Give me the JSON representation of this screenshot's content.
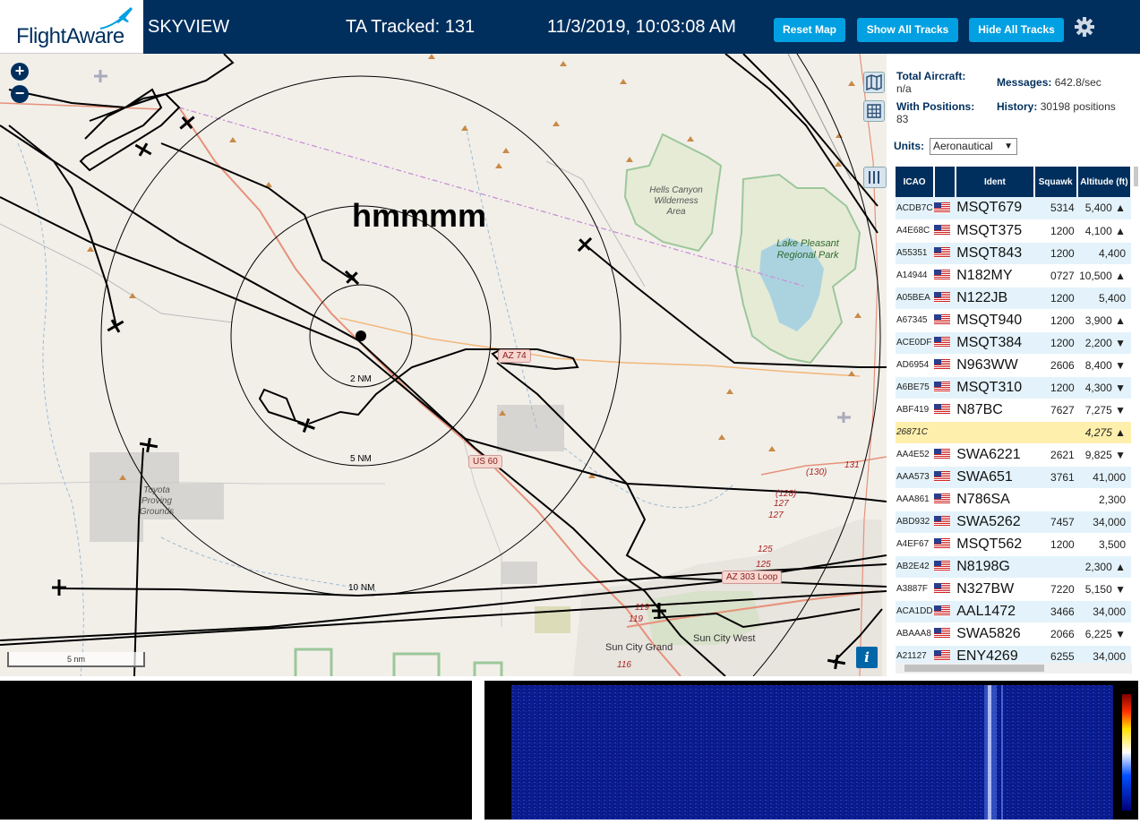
{
  "header": {
    "logo_text": "FlightAware",
    "site_name": "SKYVIEW",
    "ta_tracked": "TA Tracked: 131",
    "clock": "11/3/2019, 10:03:08 AM",
    "buttons": {
      "reset": "Reset Map",
      "show_all": "Show All Tracks",
      "hide_all": "Hide All Tracks"
    },
    "settings_icon": "gear-icon",
    "colors": {
      "bar": "#002f5d",
      "button": "#00a0e2"
    }
  },
  "map": {
    "overlay_text": "hmmmm",
    "zoom_in": "+",
    "zoom_out": "−",
    "scale_label": "5 nm",
    "info_label": "i",
    "ring_labels": [
      "2 NM",
      "5 NM",
      "10 NM"
    ],
    "road_shields": [
      "AZ 74",
      "US 60",
      "AZ 303 Loop"
    ],
    "highway_numbers": [
      "(130)",
      "131",
      "(128)",
      "127",
      "127",
      "125",
      "125",
      "119",
      "119",
      "116"
    ],
    "places": {
      "hells_canyon": "Hells Canyon Wilderness Area",
      "lake_pleasant": "Lake Pleasant Regional Park",
      "toyota": "Toyota Proving Grounds",
      "sun_city_grand": "Sun City Grand",
      "sun_city_west": "Sun City West"
    }
  },
  "sidebar": {
    "total_aircraft_label": "Total Aircraft:",
    "total_aircraft_value": "n/a",
    "messages_label": "Messages:",
    "messages_value": "642.8/sec",
    "with_positions_label": "With Positions:",
    "with_positions_value": "83",
    "history_label": "History:",
    "history_value": "30198 positions",
    "units_label": "Units:",
    "units_value": "Aeronautical",
    "columns": [
      "ICAO",
      "Ident",
      "Squawk",
      "Altitude (ft)"
    ],
    "rows": [
      {
        "icao": "ACDB7C",
        "ident": "MSQT679",
        "squawk": "5314",
        "alt": "5,400 ▲"
      },
      {
        "icao": "A4E68C",
        "ident": "MSQT375",
        "squawk": "1200",
        "alt": "4,100 ▲"
      },
      {
        "icao": "A55351",
        "ident": "MSQT843",
        "squawk": "1200",
        "alt": "4,400"
      },
      {
        "icao": "A14944",
        "ident": "N182MY",
        "squawk": "0727",
        "alt": "10,500 ▲"
      },
      {
        "icao": "A05BEA",
        "ident": "N122JB",
        "squawk": "1200",
        "alt": "5,400"
      },
      {
        "icao": "A67345",
        "ident": "MSQT940",
        "squawk": "1200",
        "alt": "3,900 ▲"
      },
      {
        "icao": "ACE0DF",
        "ident": "MSQT384",
        "squawk": "1200",
        "alt": "2,200 ▼"
      },
      {
        "icao": "AD6954",
        "ident": "N963WW",
        "squawk": "2606",
        "alt": "8,400 ▼"
      },
      {
        "icao": "A6BE75",
        "ident": "MSQT310",
        "squawk": "1200",
        "alt": "4,300 ▼"
      },
      {
        "icao": "ABF419",
        "ident": "N87BC",
        "squawk": "7627",
        "alt": "7,275 ▼"
      },
      {
        "icao": "26871C",
        "ident": "",
        "squawk": "",
        "alt": "4,275 ▲",
        "highlight": true
      },
      {
        "icao": "AA4E52",
        "ident": "SWA6221",
        "squawk": "2621",
        "alt": "9,825 ▼"
      },
      {
        "icao": "AAA573",
        "ident": "SWA651",
        "squawk": "3761",
        "alt": "41,000"
      },
      {
        "icao": "AAA861",
        "ident": "N786SA",
        "squawk": "",
        "alt": "2,300"
      },
      {
        "icao": "ABD932",
        "ident": "SWA5262",
        "squawk": "7457",
        "alt": "34,000"
      },
      {
        "icao": "A4EF67",
        "ident": "MSQT562",
        "squawk": "1200",
        "alt": "3,500"
      },
      {
        "icao": "AB2E42",
        "ident": "N8198G",
        "squawk": "",
        "alt": "2,300 ▲"
      },
      {
        "icao": "A3887F",
        "ident": "N327BW",
        "squawk": "7220",
        "alt": "5,150 ▼"
      },
      {
        "icao": "ACA1DD",
        "ident": "AAL1472",
        "squawk": "3466",
        "alt": "34,000"
      },
      {
        "icao": "ABAAA8",
        "ident": "SWA5826",
        "squawk": "2066",
        "alt": "6,225 ▼"
      },
      {
        "icao": "A21127",
        "ident": "ENY4269",
        "squawk": "6255",
        "alt": "34,000"
      }
    ],
    "colors": {
      "header": "#002f5d",
      "row_alt": "#e4f3fb",
      "highlight": "#ffefac"
    }
  },
  "bottom": {
    "left_panel": "black",
    "right_panel": "waterfall-spectrogram"
  }
}
